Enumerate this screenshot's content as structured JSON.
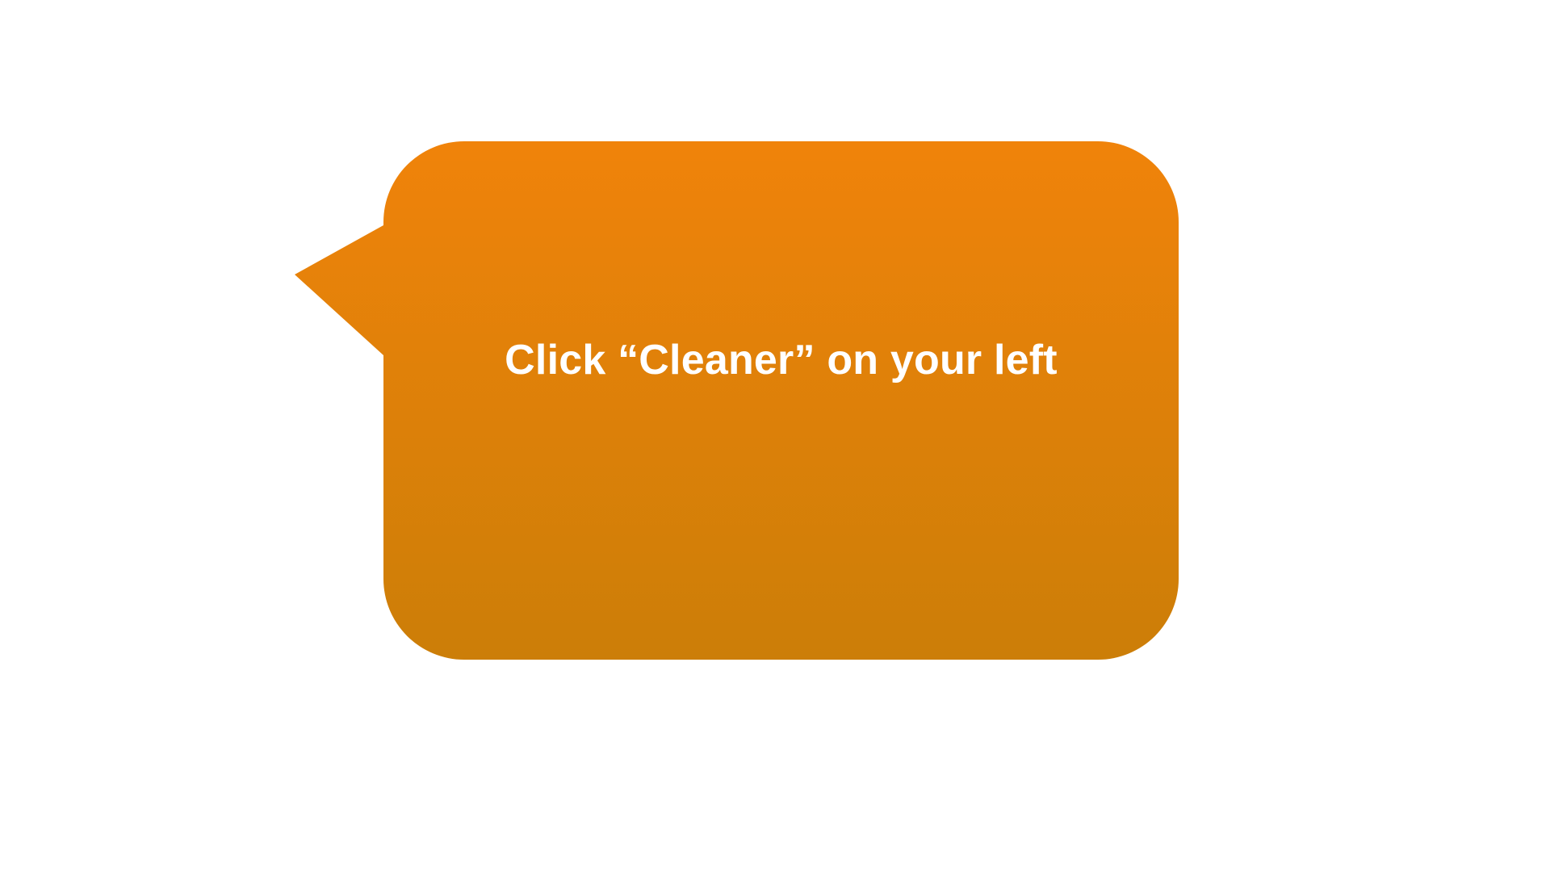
{
  "callout": {
    "text": "Click “Cleaner” on your left",
    "colors": {
      "fill_top": "#F0830A",
      "fill_bottom": "#CC7E08",
      "text": "#FFFFFF",
      "background": "#FFFFFF"
    }
  }
}
